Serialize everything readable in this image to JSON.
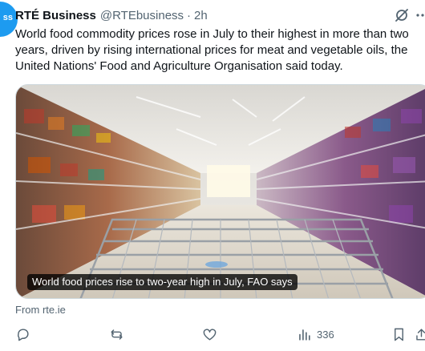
{
  "tweet": {
    "display_name": "RTÉ Business",
    "handle": "@RTEbusiness",
    "separator": "·",
    "time": "2h",
    "avatar_text": "ss",
    "text": "World food commodity prices rose in July to their highest in more than two years, driven by rising international prices for meat and vegetable oils, the United Nations' Food and Agriculture Organisation said today.",
    "media": {
      "caption": "World food prices rise to two-year high in July, FAO says"
    },
    "source": "From rte.ie",
    "views_count": "336"
  },
  "colors": {
    "accent": "#1d9bf0",
    "text_primary": "#0f1419",
    "text_secondary": "#536471",
    "border": "#cfd9de"
  },
  "icons": {
    "reply": "reply-icon",
    "retweet": "retweet-icon",
    "like": "heart-icon",
    "views": "bar-chart-icon",
    "bookmark": "bookmark-icon",
    "share": "share-icon",
    "grok": "grok-icon",
    "more": "more-icon"
  }
}
